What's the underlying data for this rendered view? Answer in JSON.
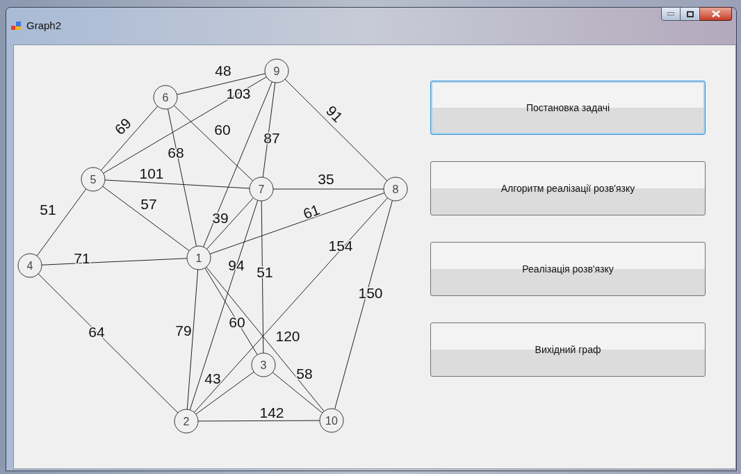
{
  "window": {
    "title": "Graph2"
  },
  "graph": {
    "nodes": [
      "1",
      "2",
      "3",
      "4",
      "5",
      "6",
      "7",
      "8",
      "9",
      "10"
    ],
    "edges": [
      {
        "weight": "48"
      },
      {
        "weight": "103"
      },
      {
        "weight": "69"
      },
      {
        "weight": "68"
      },
      {
        "weight": "60"
      },
      {
        "weight": "87"
      },
      {
        "weight": "91"
      },
      {
        "weight": "101"
      },
      {
        "weight": "35"
      },
      {
        "weight": "51"
      },
      {
        "weight": "57"
      },
      {
        "weight": "39"
      },
      {
        "weight": "61"
      },
      {
        "weight": "71"
      },
      {
        "weight": "154"
      },
      {
        "weight": "94"
      },
      {
        "weight": "51"
      },
      {
        "weight": "150"
      },
      {
        "weight": "64"
      },
      {
        "weight": "79"
      },
      {
        "weight": "60"
      },
      {
        "weight": "120"
      },
      {
        "weight": "43"
      },
      {
        "weight": "58"
      },
      {
        "weight": "142"
      }
    ]
  },
  "buttons": [
    {
      "label": "Постановка задачі",
      "focused": true
    },
    {
      "label": "Алгоритм реалізації розв'язку",
      "focused": false
    },
    {
      "label": "Реалізація розв'язку",
      "focused": false
    },
    {
      "label": "Вихідний граф",
      "focused": false
    }
  ]
}
